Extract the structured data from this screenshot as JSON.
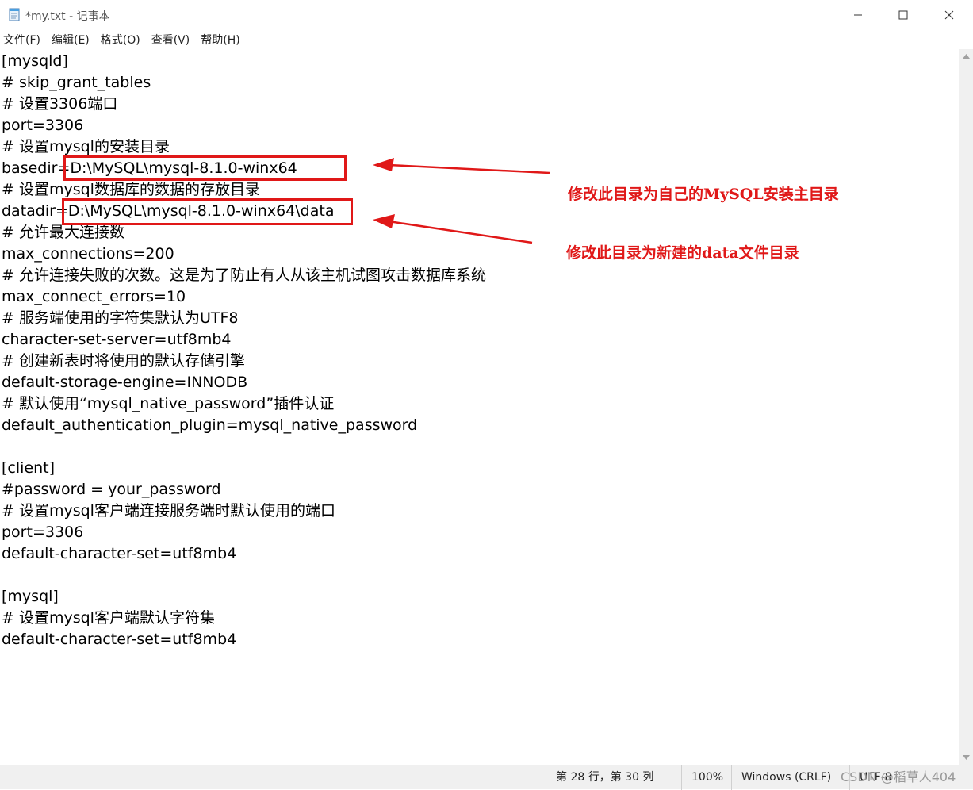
{
  "window": {
    "title": "*my.txt - 记事本",
    "app_icon": "notepad-icon",
    "buttons": [
      "minimize-icon",
      "maximize-icon",
      "close-icon"
    ]
  },
  "menu": [
    "文件(F)",
    "编辑(E)",
    "格式(O)",
    "查看(V)",
    "帮助(H)"
  ],
  "lines": [
    "[mysqld]",
    "# skip_grant_tables",
    "# 设置3306端口",
    "port=3306",
    "# 设置mysql的安装目录",
    "basedir=D:\\MySQL\\mysql-8.1.0-winx64",
    "# 设置mysql数据库的数据的存放目录",
    "datadir=D:\\MySQL\\mysql-8.1.0-winx64\\data",
    "# 允许最大连接数",
    "max_connections=200",
    "# 允许连接失败的次数。这是为了防止有人从该主机试图攻击数据库系统",
    "max_connect_errors=10",
    "# 服务端使用的字符集默认为UTF8",
    "character-set-server=utf8mb4",
    "# 创建新表时将使用的默认存储引擎",
    "default-storage-engine=INNODB",
    "# 默认使用“mysql_native_password”插件认证",
    "default_authentication_plugin=mysql_native_password",
    "",
    "[client]",
    "#password = your_password",
    "# 设置mysql客户端连接服务端时默认使用的端口",
    "port=3306",
    "default-character-set=utf8mb4",
    "",
    "[mysql]",
    "# 设置mysql客户端默认字符集",
    "default-character-set=utf8mb4"
  ],
  "annotations": {
    "basedir_note": "修改此目录为自己的MySQL安装主目录",
    "datadir_note": "修改此目录为新建的data文件目录",
    "color": "#e01818"
  },
  "status": {
    "position": "第 28 行，第 30 列",
    "zoom": "100%",
    "line_ending": "Windows (CRLF)",
    "encoding": "UTF-8"
  },
  "watermark": "CSDN @稻草人404"
}
